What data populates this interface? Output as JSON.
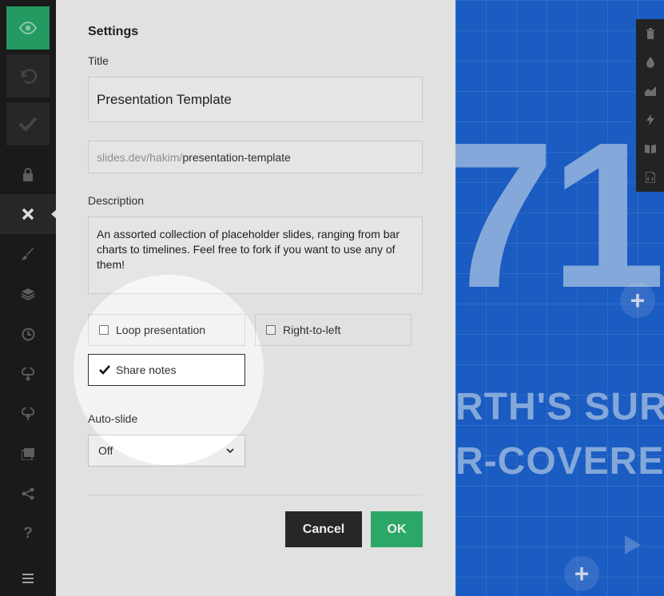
{
  "toolbar": {
    "items": [
      "preview",
      "undo",
      "save",
      "lock",
      "close",
      "style",
      "layers",
      "history",
      "import",
      "export",
      "media",
      "share",
      "help",
      "menu"
    ]
  },
  "settings": {
    "heading": "Settings",
    "title_label": "Title",
    "title_value": "Presentation Template",
    "url_prefix": "slides.dev/hakim/",
    "url_slug": "presentation-template",
    "description_label": "Description",
    "description_value": "An assorted collection of placeholder slides, ranging from bar charts to timelines. Feel free to fork if you want to use any of them!",
    "loop_label": "Loop presentation",
    "rtl_label": "Right-to-left",
    "share_notes_label": "Share notes",
    "autoslide_label": "Auto-slide",
    "autoslide_value": "Off",
    "cancel_label": "Cancel",
    "ok_label": "OK"
  },
  "slide": {
    "big_text": "71",
    "line1": "RTH'S SUR",
    "line2": "R-COVERE",
    "add_symbol": "+"
  },
  "colors": {
    "accent_green": "#27a56a",
    "slide_blue": "#1d63d0",
    "panel_bg": "#f3f3f3"
  }
}
